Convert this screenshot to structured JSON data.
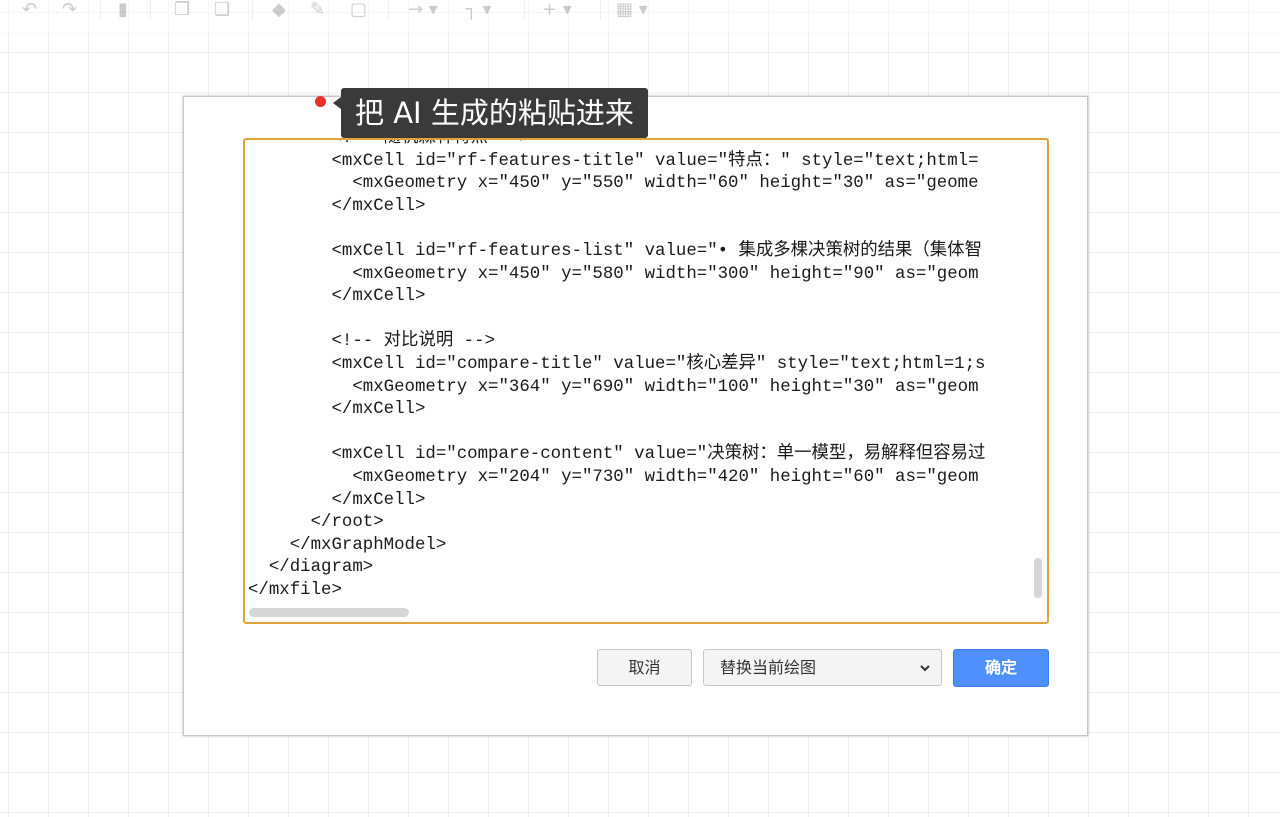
{
  "toolbar": {
    "icons": [
      "undo-icon",
      "redo-icon",
      "delete-icon",
      "to-front-icon",
      "to-back-icon",
      "fill-color-icon",
      "line-color-icon",
      "shadow-icon",
      "connection-icon",
      "waypoints-icon",
      "insert-icon",
      "table-icon"
    ]
  },
  "callout": {
    "text": "把 AI 生成的粘贴进来",
    "dot_color": "#e8312a"
  },
  "editor": {
    "border_color": "#e0a33a",
    "lines": [
      "        <!-- 随机森林特点 -->",
      "        <mxCell id=\"rf-features-title\" value=\"特点：\" style=\"text;html=",
      "          <mxGeometry x=\"450\" y=\"550\" width=\"60\" height=\"30\" as=\"geome",
      "        </mxCell>",
      "",
      "        <mxCell id=\"rf-features-list\" value=\"• 集成多棵决策树的结果（集体智",
      "          <mxGeometry x=\"450\" y=\"580\" width=\"300\" height=\"90\" as=\"geom",
      "        </mxCell>",
      "",
      "        <!-- 对比说明 -->",
      "        <mxCell id=\"compare-title\" value=\"核心差异\" style=\"text;html=1;s",
      "          <mxGeometry x=\"364\" y=\"690\" width=\"100\" height=\"30\" as=\"geom",
      "        </mxCell>",
      "",
      "        <mxCell id=\"compare-content\" value=\"决策树：单一模型，易解释但容易过",
      "          <mxGeometry x=\"204\" y=\"730\" width=\"420\" height=\"60\" as=\"geom",
      "        </mxCell>",
      "      </root>",
      "    </mxGraphModel>",
      "  </diagram>",
      "</mxfile>"
    ]
  },
  "buttons": {
    "cancel_label": "取消",
    "ok_label": "确定",
    "ok_color": "#4d90fe"
  },
  "mode_select": {
    "selected": "替换当前绘图"
  }
}
